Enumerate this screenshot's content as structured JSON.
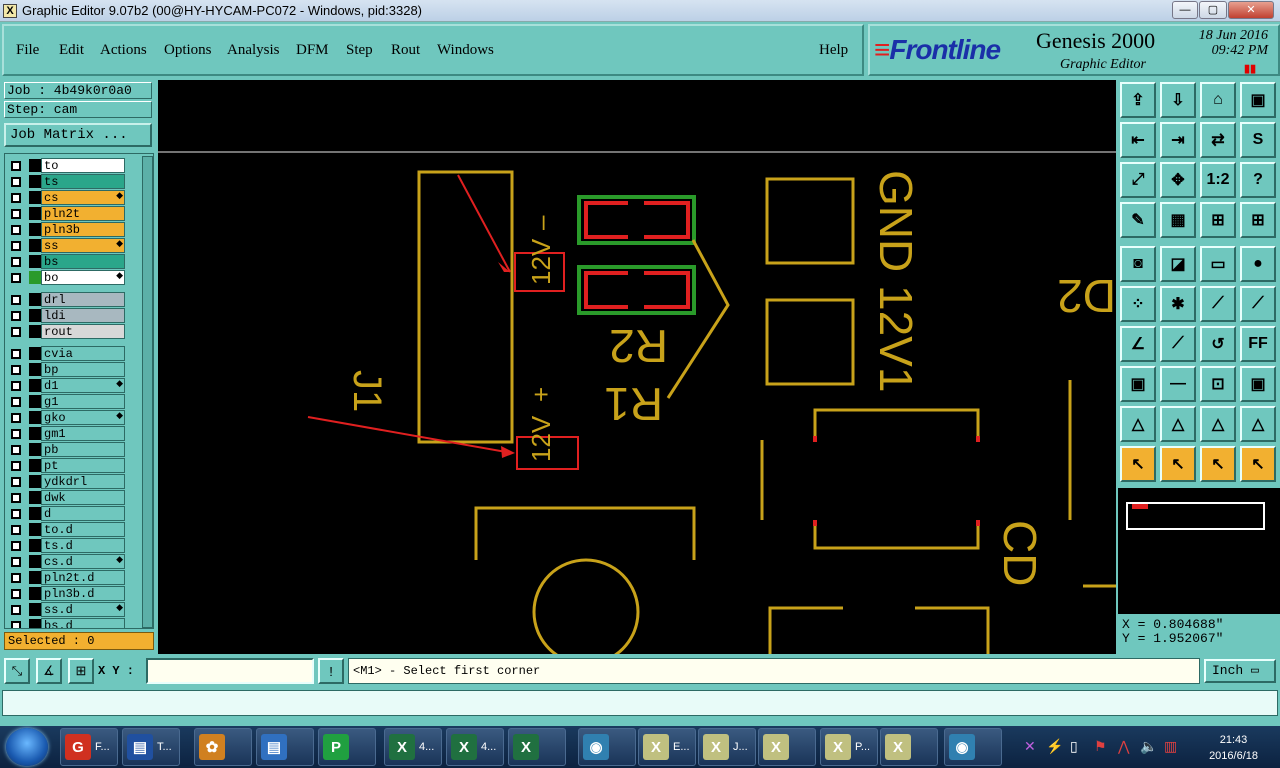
{
  "window": {
    "title": "Graphic Editor 9.07b2 (00@HY-HYCAM-PC072 - Windows, pid:3328)",
    "app_icon": "X",
    "min": "—",
    "max": "▢",
    "close": "✕"
  },
  "menu": {
    "items": [
      "File",
      "Edit",
      "Actions",
      "Options",
      "Analysis",
      "DFM",
      "Step",
      "Rout",
      "Windows"
    ],
    "help": "Help"
  },
  "brand": {
    "logo": "Frontline",
    "product": "Genesis 2000",
    "subtitle": "Graphic Editor",
    "date": "18 Jun 2016",
    "time": "09:42 PM",
    "pause": "▮▮"
  },
  "job": {
    "job": "Job : 4b49k0r0a0",
    "step": "Step: cam",
    "matrix_button": "Job Matrix ..."
  },
  "layers": [
    {
      "name": "to",
      "color": "#ffffff",
      "mark": ""
    },
    {
      "name": "ts",
      "color": "#2aa68a",
      "mark": ""
    },
    {
      "name": "cs",
      "color": "#f2b030",
      "mark": "◆"
    },
    {
      "name": "pln2t",
      "color": "#f2b030",
      "mark": ""
    },
    {
      "name": "pln3b",
      "color": "#f2b030",
      "mark": ""
    },
    {
      "name": "ss",
      "color": "#f2b030",
      "mark": "◆"
    },
    {
      "name": "bs",
      "color": "#2aa68a",
      "mark": ""
    },
    {
      "name": "bo",
      "color": "#ffffff",
      "mark": "◆",
      "active": true
    },
    {
      "name": "drl",
      "color": "#a8b8c0",
      "mark": "",
      "gap": true
    },
    {
      "name": "ldi",
      "color": "#a8b8c0",
      "mark": ""
    },
    {
      "name": "rout",
      "color": "#d8d8d8",
      "mark": ""
    },
    {
      "name": "cvia",
      "color": "#6fc7be",
      "mark": "",
      "gap": true
    },
    {
      "name": "bp",
      "color": "#6fc7be",
      "mark": ""
    },
    {
      "name": "d1",
      "color": "#6fc7be",
      "mark": "◆"
    },
    {
      "name": "g1",
      "color": "#6fc7be",
      "mark": ""
    },
    {
      "name": "gko",
      "color": "#6fc7be",
      "mark": "◆"
    },
    {
      "name": "gm1",
      "color": "#6fc7be",
      "mark": ""
    },
    {
      "name": "pb",
      "color": "#6fc7be",
      "mark": ""
    },
    {
      "name": "pt",
      "color": "#6fc7be",
      "mark": ""
    },
    {
      "name": "ydkdrl",
      "color": "#6fc7be",
      "mark": ""
    },
    {
      "name": "dwk",
      "color": "#6fc7be",
      "mark": ""
    },
    {
      "name": "d",
      "color": "#6fc7be",
      "mark": ""
    },
    {
      "name": "to.d",
      "color": "#6fc7be",
      "mark": ""
    },
    {
      "name": "ts.d",
      "color": "#6fc7be",
      "mark": ""
    },
    {
      "name": "cs.d",
      "color": "#6fc7be",
      "mark": "◆"
    },
    {
      "name": "pln2t.d",
      "color": "#6fc7be",
      "mark": ""
    },
    {
      "name": "pln3b.d",
      "color": "#6fc7be",
      "mark": ""
    },
    {
      "name": "ss.d",
      "color": "#6fc7be",
      "mark": "◆"
    },
    {
      "name": "bs.d",
      "color": "#6fc7be",
      "mark": ""
    }
  ],
  "selected": "Selected : 0",
  "canvas": {
    "labels": {
      "r2": "R2",
      "r1": "R1",
      "j1": "J1",
      "gnd": "GND",
      "v12": "12V1",
      "v12_minus": "12V-",
      "v12_plus": "12V+",
      "cd": "CD",
      "d2": "D2",
      "m12v_1": "12V",
      "m12v_2": "12V"
    },
    "colors": {
      "silk": "#c8a21a",
      "mask": "#2a9a2a",
      "pad": "#e02020",
      "arrow": "#e02020"
    }
  },
  "toolbar": {
    "icons": [
      "export-icon",
      "import-icon",
      "home-icon",
      "window-icon",
      "pan-left-icon",
      "pan-right-icon",
      "swap-icon",
      "snap-icon",
      "zoom-fit-icon",
      "zoom-center-icon",
      "zoom-ratio-icon",
      "help-icon",
      "measure-icon",
      "grid-icon",
      "net-icon",
      "net-alt-icon",
      "pad-icon",
      "shape-icon",
      "ruler-icon",
      "dot-icon",
      "node-icon",
      "cross-icon",
      "line-node-icon",
      "line-node2-icon",
      "angle-icon",
      "edge-icon",
      "arc-icon",
      "ff-icon",
      "copy-box-icon",
      "line-red-icon",
      "move-box-icon",
      "multi-icon",
      "tri-icon",
      "tri2-icon",
      "tri3-icon",
      "tri4-icon",
      "select-icon",
      "select2-icon",
      "select3-icon",
      "select4-icon"
    ],
    "glyphs": [
      "⇪",
      "⇩",
      "⌂",
      "▣",
      "⇤",
      "⇥",
      "⇄",
      "S",
      "⤢",
      "✥",
      "1:2",
      "?",
      "✎",
      "▦",
      "⊞",
      "⊞",
      "◙",
      "◪",
      "▭",
      "●",
      "⁘",
      "✱",
      "⟋",
      "⟋",
      "∠",
      "⟋",
      "↺",
      "FF",
      "▣",
      "—",
      "⊡",
      "▣",
      "△",
      "△",
      "△",
      "△",
      "↖",
      "↖",
      "↖",
      "↖"
    ]
  },
  "coords": {
    "x": "X = 0.804688\"",
    "y": "Y = 1.952067\""
  },
  "status": {
    "xy_label": "X Y :",
    "xy_value": "",
    "prompt": "<M1> - Select first corner",
    "unit": "Inch ▭",
    "message": ""
  },
  "taskbar": {
    "items": [
      {
        "label": "F...",
        "icon": "G",
        "color": "#d03020"
      },
      {
        "label": "T...",
        "icon": "▤",
        "color": "#2050a0"
      },
      {
        "label": "",
        "icon": "✿",
        "color": "#d08020"
      },
      {
        "label": "",
        "icon": "▤",
        "color": "#3070c0"
      },
      {
        "label": "",
        "icon": "P",
        "color": "#20a040"
      },
      {
        "label": "4...",
        "icon": "X",
        "color": "#207040"
      },
      {
        "label": "4...",
        "icon": "X",
        "color": "#207040"
      },
      {
        "label": "",
        "icon": "X",
        "color": "#207040"
      },
      {
        "label": "",
        "icon": "◉",
        "color": "#3080b0"
      },
      {
        "label": "E...",
        "icon": "X",
        "color": "#c0c080"
      },
      {
        "label": "J...",
        "icon": "X",
        "color": "#c0c080"
      },
      {
        "label": "",
        "icon": "X",
        "color": "#c0c080"
      },
      {
        "label": "P...",
        "icon": "X",
        "color": "#c0c080"
      },
      {
        "label": "",
        "icon": "X",
        "color": "#c0c080"
      },
      {
        "label": "",
        "icon": "◉",
        "color": "#3080b0"
      }
    ],
    "time": "21:43",
    "date": "2016/6/18"
  }
}
